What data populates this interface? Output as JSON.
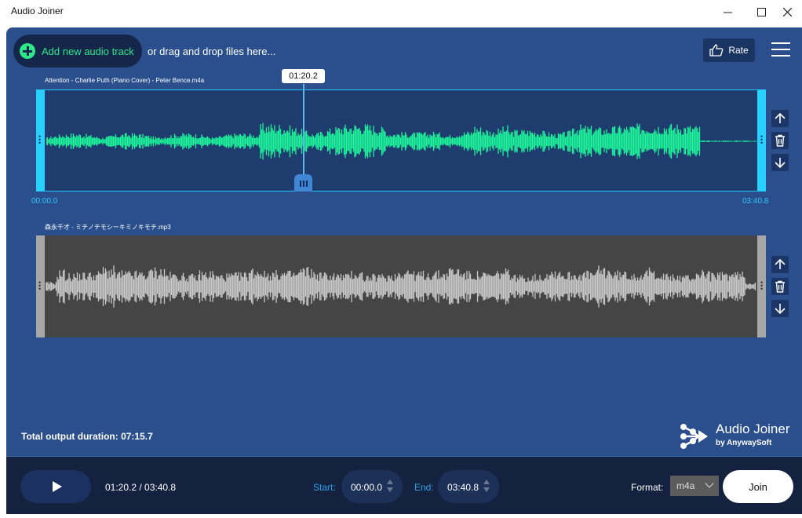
{
  "window": {
    "title": "Audio Joiner",
    "minimize_glyph": "—",
    "maximize_glyph": "☐",
    "close_glyph": "✕"
  },
  "toolbar": {
    "add_track_label": "Add new audio track",
    "drag_hint": "or drag and drop files here...",
    "rate_label": "Rate",
    "rate_icon": "thumbs-up-icon",
    "menu_icon": "hamburger-menu-icon"
  },
  "tracks": [
    {
      "name": "Attention - Charlie Puth (Piano Cover) - Peter Bence.m4a",
      "start_label": "00:00.0",
      "end_label": "03:40.8",
      "playhead_label": "01:20.2",
      "selected": true,
      "wave_color": "#1df59a",
      "border_color": "#22c9ff"
    },
    {
      "name": "森永千才 - ミチノチモシーキミノキモチ.mp3",
      "selected": false,
      "wave_color": "#c8c8c8"
    }
  ],
  "side_buttons": {
    "up_icon": "arrow-up-icon",
    "delete_icon": "trash-icon",
    "down_icon": "arrow-down-icon"
  },
  "summary": {
    "total_duration": "Total output duration: 07:15.7"
  },
  "brand": {
    "name": "Audio Joiner",
    "sub": "by AnywaySoft"
  },
  "player": {
    "position_text": "01:20.2 / 03:40.8",
    "start_label": "Start:",
    "start_value": "00:00.0",
    "end_label": "End:",
    "end_value": "03:40.8",
    "format_label": "Format:",
    "format_value": "m4a",
    "join_label": "Join"
  },
  "colors": {
    "app_bg": "#2a4f8c",
    "accent_green": "#2ee88a",
    "accent_cyan": "#27d0ff",
    "player_bar_bg": "#14223f"
  }
}
